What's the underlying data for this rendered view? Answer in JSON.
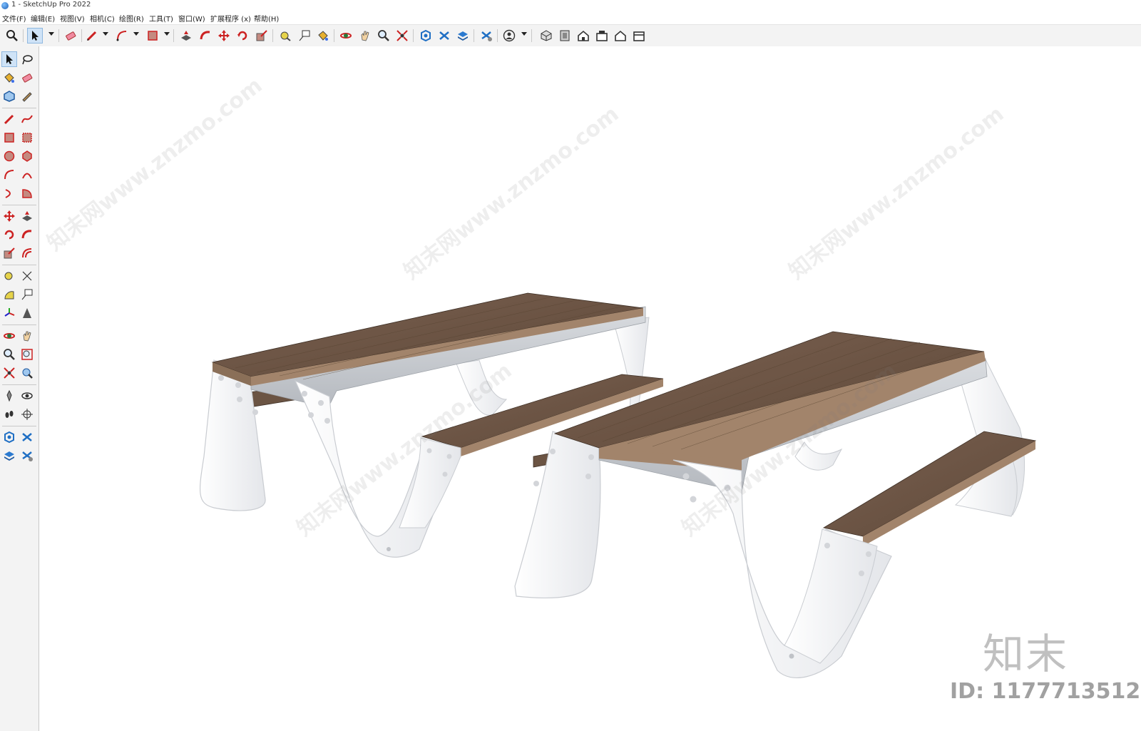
{
  "window": {
    "title": "1 - SketchUp Pro 2022"
  },
  "menu": [
    {
      "label": "文件(F)"
    },
    {
      "label": "编辑(E)"
    },
    {
      "label": "视图(V)"
    },
    {
      "label": "相机(C)"
    },
    {
      "label": "绘图(R)"
    },
    {
      "label": "工具(T)"
    },
    {
      "label": "窗口(W)"
    },
    {
      "label": "扩展程序 (x)"
    },
    {
      "label": "帮助(H)"
    }
  ],
  "watermark": {
    "text": "知末网www.znzmo.com",
    "brand": "知末",
    "id": "ID: 1177713512"
  },
  "colors": {
    "wood": "#6b5443",
    "wood_light": "#8a6f58",
    "metal": "#c9ccd1",
    "frame": "#ffffff",
    "selected": "#cfe3f7"
  }
}
